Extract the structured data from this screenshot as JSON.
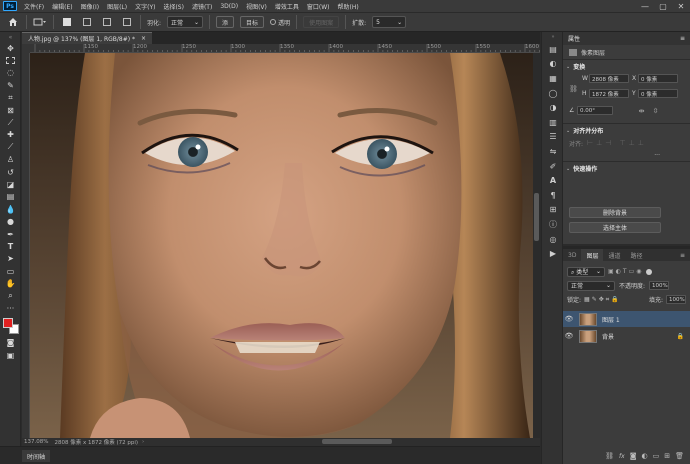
{
  "app": {
    "logo": "Ps"
  },
  "menu": [
    "文件(F)",
    "编辑(E)",
    "图像(I)",
    "图层(L)",
    "文字(Y)",
    "选择(S)",
    "滤镜(T)",
    "3D(D)",
    "视图(V)",
    "增效工具",
    "窗口(W)",
    "帮助(H)"
  ],
  "window_controls": {
    "minimize": "—",
    "restore": "▢",
    "close": "✕"
  },
  "options": {
    "feather_label": "羽化:",
    "style_label": "正常",
    "btn_rgb": "添",
    "btn_subtract": "目标",
    "transparent_label": "透明",
    "use_pattern": "使用图案",
    "spread_label": "扩散:",
    "spread_value": "5"
  },
  "document": {
    "tab_title": "人物.jpg @ 137% (图层 1, RGB/8#) *",
    "tab_close": "×",
    "zoom_status": "137.08%",
    "size_status": "2808 像素 x 1872 像素 (72 ppi)"
  },
  "ruler_h": [
    "1150",
    "1200",
    "1250",
    "1300",
    "1350",
    "1400",
    "1450",
    "1500",
    "1550",
    "1600",
    "1650",
    "1700",
    "1750"
  ],
  "timeline_tab": "时间轴",
  "properties": {
    "title": "属性",
    "menu_icon": "≡",
    "layer_type": "像素图层",
    "transform_title": "变换",
    "w_label": "W",
    "w_value": "2808 像素",
    "x_label": "X",
    "x_value": "0 像素",
    "h_label": "H",
    "h_value": "1872 像素",
    "y_label": "Y",
    "y_value": "0 像素",
    "angle_value": "0.00°",
    "align_title": "对齐并分布",
    "align_label": "对齐:",
    "more": "···",
    "quick_title": "快速操作",
    "remove_bg": "删除背景",
    "select_subject": "选择主体"
  },
  "layers": {
    "tabs": [
      "3D",
      "图层",
      "通道",
      "路径"
    ],
    "active_tab": "图层",
    "kind_filter": "类型",
    "blend_mode": "正常",
    "opacity_label": "不透明度:",
    "opacity_value": "100%",
    "lock_label": "锁定:",
    "fill_label": "填充:",
    "fill_value": "100%",
    "items": [
      {
        "name": "图层 1",
        "selected": true,
        "locked": false
      },
      {
        "name": "背景",
        "selected": false,
        "locked": true
      }
    ]
  },
  "colors": {
    "accent": "#31a8ff",
    "foreground": "#e02020",
    "background": "#ffffff",
    "selected_layer": "#3d5570"
  }
}
